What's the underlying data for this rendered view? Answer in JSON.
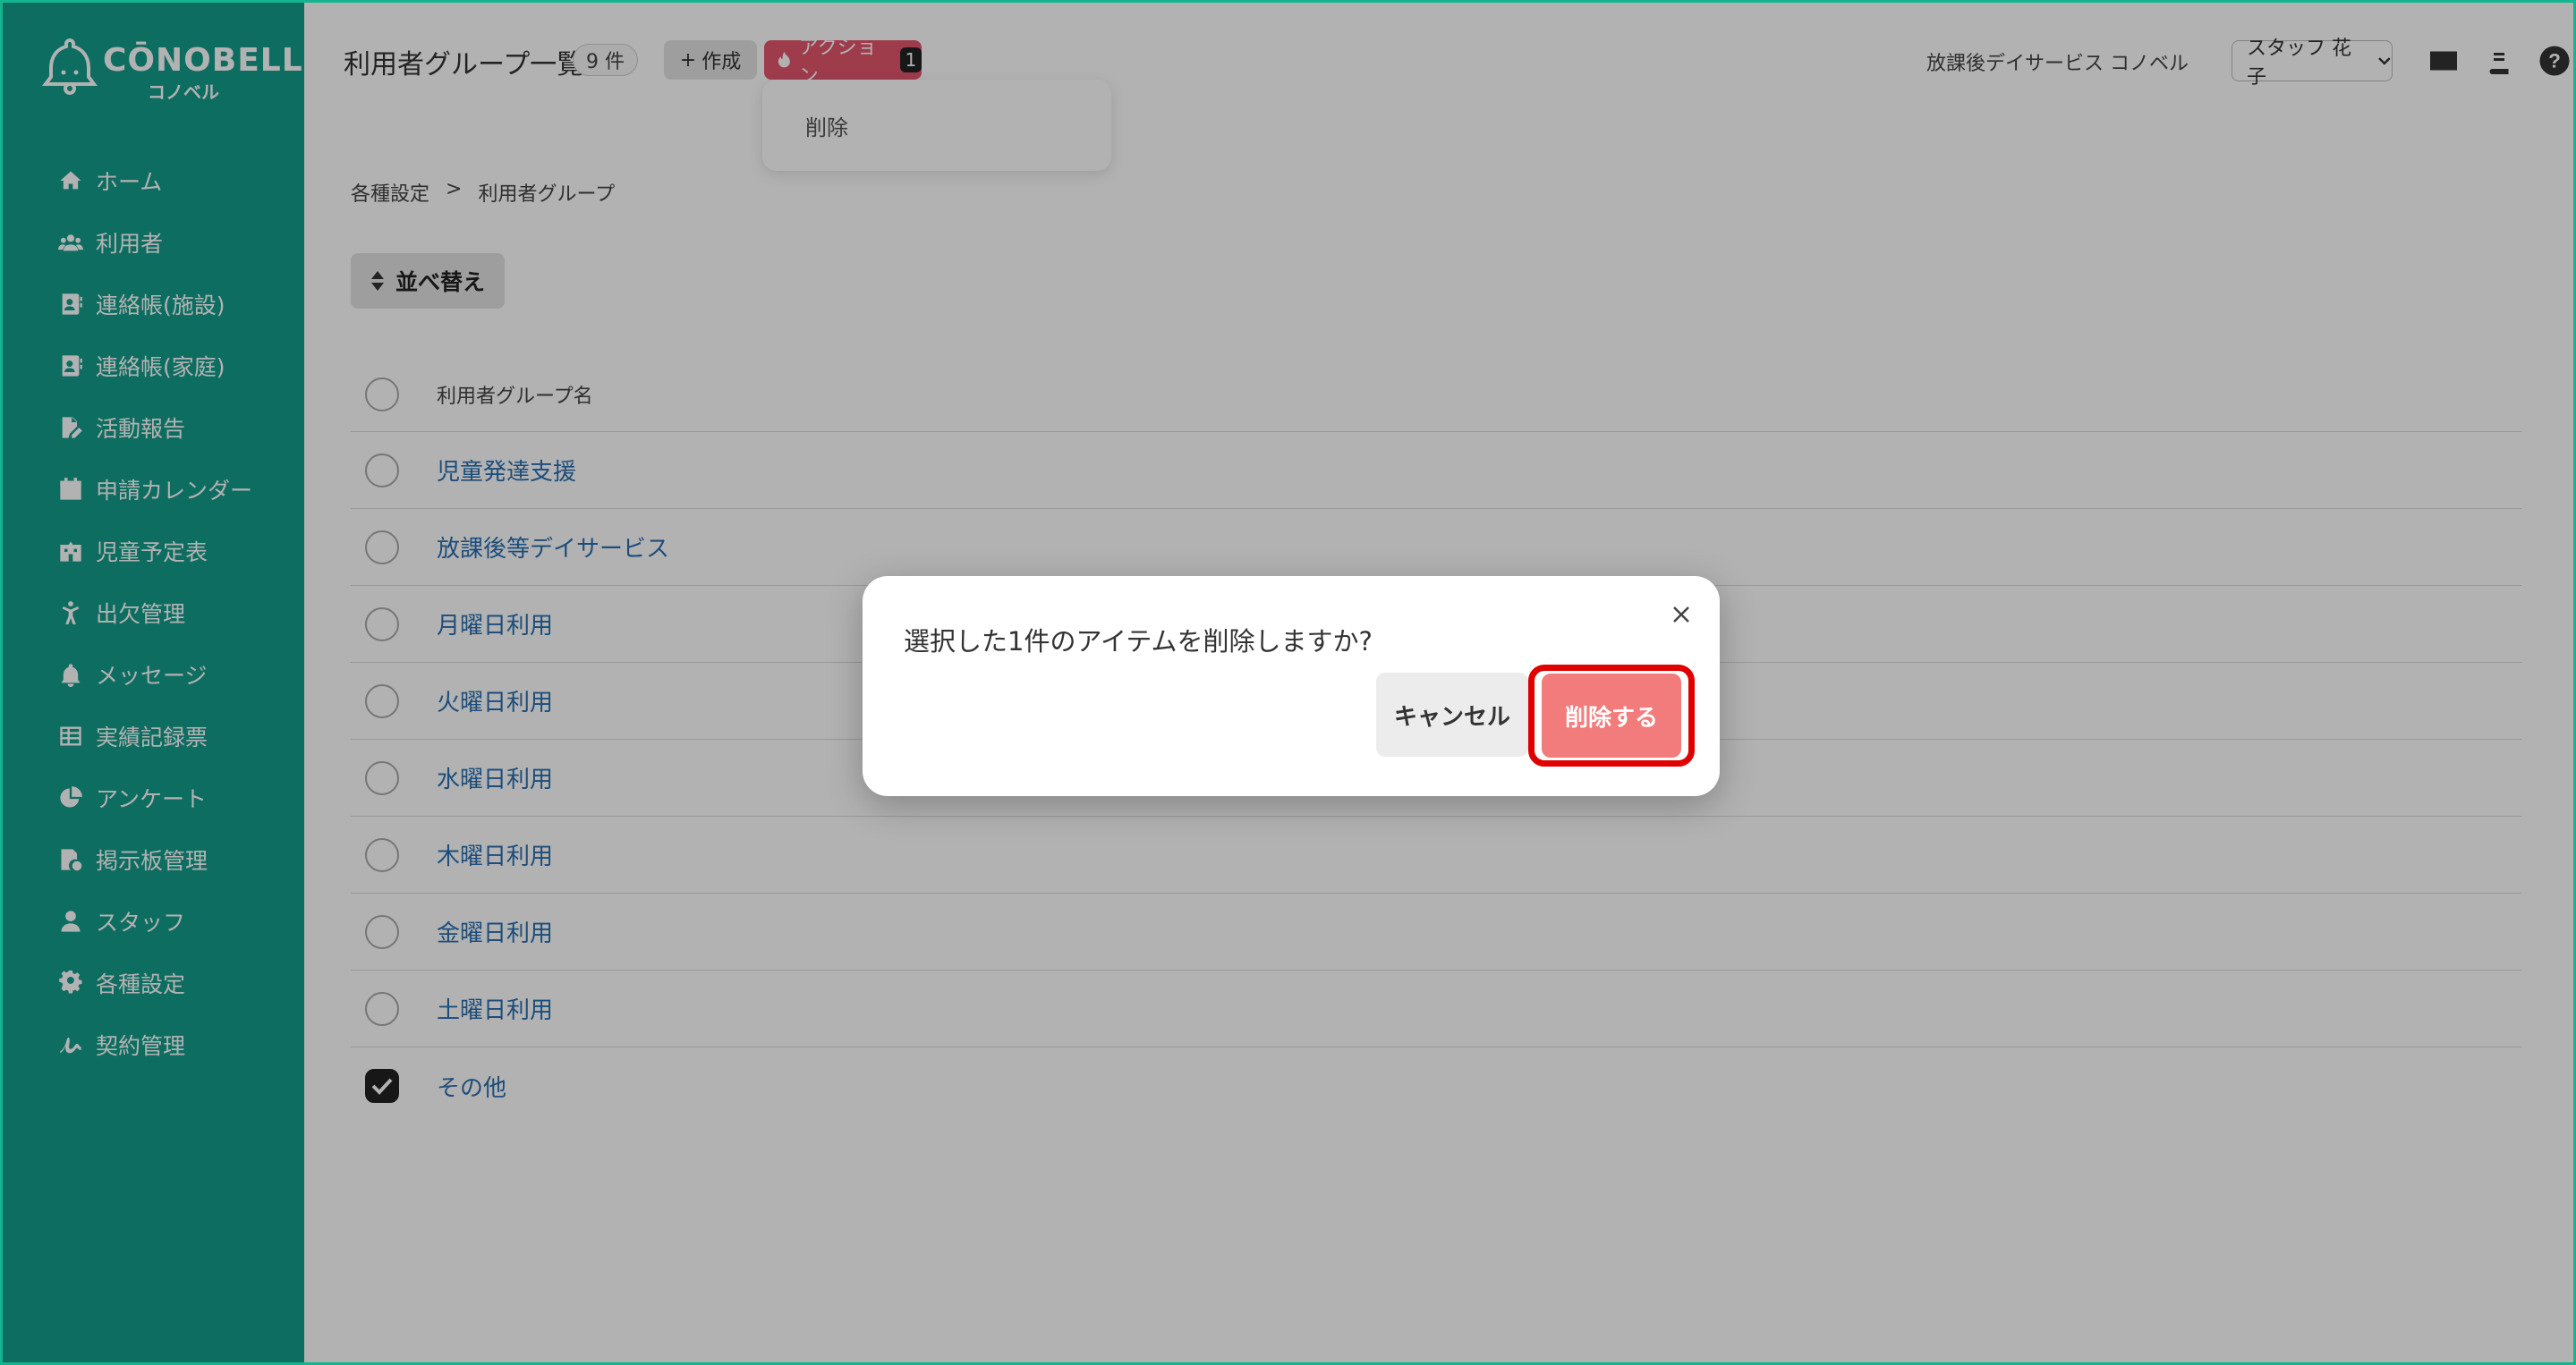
{
  "brand": {
    "name": "CŌNOBELL",
    "kana": "コノベル"
  },
  "sidebar": {
    "items": [
      {
        "label": "ホーム",
        "icon": "home-icon"
      },
      {
        "label": "利用者",
        "icon": "users-icon"
      },
      {
        "label": "連絡帳(施設)",
        "icon": "contact-book-icon"
      },
      {
        "label": "連絡帳(家庭)",
        "icon": "contact-book-icon"
      },
      {
        "label": "活動報告",
        "icon": "report-edit-icon"
      },
      {
        "label": "申請カレンダー",
        "icon": "calendar-icon"
      },
      {
        "label": "児童予定表",
        "icon": "schedule-icon"
      },
      {
        "label": "出欠管理",
        "icon": "attendance-icon"
      },
      {
        "label": "メッセージ",
        "icon": "bell-icon"
      },
      {
        "label": "実績記録票",
        "icon": "table-icon"
      },
      {
        "label": "アンケート",
        "icon": "pie-chart-icon"
      },
      {
        "label": "掲示板管理",
        "icon": "bulletin-icon"
      },
      {
        "label": "スタッフ",
        "icon": "staff-icon"
      },
      {
        "label": "各種設定",
        "icon": "gear-icon"
      },
      {
        "label": "契約管理",
        "icon": "contract-icon"
      }
    ]
  },
  "header": {
    "title": "利用者グループ一覧",
    "count": "9 件",
    "create_label": "作成",
    "action_label": "アクション",
    "action_count": "1",
    "dropdown_item": "削除",
    "facility": "放課後デイサービス コノベル",
    "staff": "スタッフ 花子"
  },
  "breadcrumb": {
    "parent": "各種設定",
    "separator": ">",
    "current": "利用者グループ"
  },
  "sort_label": "並べ替え",
  "table": {
    "header": "利用者グループ名",
    "rows": [
      {
        "name": "児童発達支援",
        "checked": false
      },
      {
        "name": "放課後等デイサービス",
        "checked": false
      },
      {
        "name": "月曜日利用",
        "checked": false
      },
      {
        "name": "火曜日利用",
        "checked": false
      },
      {
        "name": "水曜日利用",
        "checked": false
      },
      {
        "name": "木曜日利用",
        "checked": false
      },
      {
        "name": "金曜日利用",
        "checked": false
      },
      {
        "name": "土曜日利用",
        "checked": false
      },
      {
        "name": "その他",
        "checked": true
      }
    ]
  },
  "modal": {
    "message": "選択した1件のアイテムを削除しますか?",
    "cancel_label": "キャンセル",
    "confirm_label": "削除する"
  },
  "colors": {
    "sidebar": "#149c8b",
    "action": "#e3566e",
    "confirm": "#f27b7b",
    "highlight": "#e00000",
    "link": "#2a6fb0"
  }
}
